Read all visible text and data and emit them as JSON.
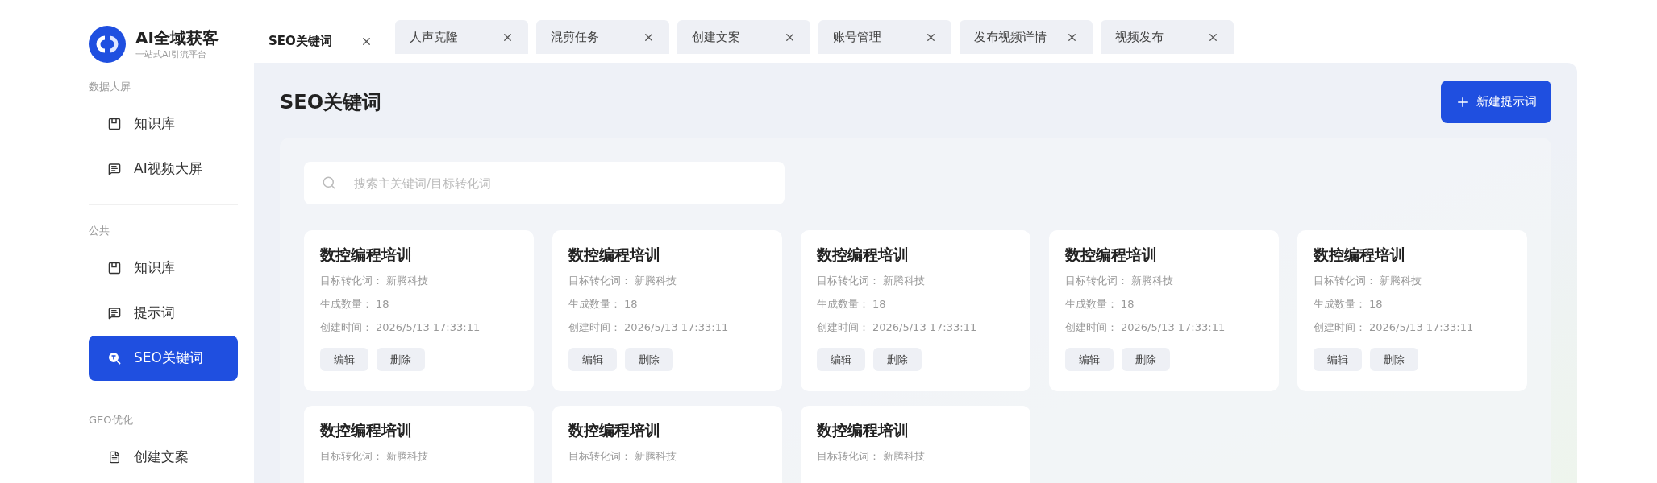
{
  "brand": {
    "title": "AI全域获客",
    "subtitle": "一站式AI引流平台"
  },
  "sidebar": {
    "sections": [
      {
        "title": "数据大屏",
        "items": [
          {
            "label": "知识库",
            "kind": "book",
            "selected": false
          },
          {
            "label": "AI视频大屏",
            "kind": "comment",
            "selected": false
          }
        ]
      },
      {
        "title": "公共",
        "items": [
          {
            "label": "知识库",
            "kind": "book",
            "selected": false
          },
          {
            "label": "提示词",
            "kind": "comment",
            "selected": false
          },
          {
            "label": "SEO关键词",
            "kind": "search",
            "selected": true
          }
        ]
      },
      {
        "title": "GEO优化",
        "items": [
          {
            "label": "创建文案",
            "kind": "doc",
            "selected": false
          }
        ]
      }
    ]
  },
  "tabs": [
    {
      "label": "SEO关键词",
      "selected": true
    },
    {
      "label": "人声克隆",
      "selected": false
    },
    {
      "label": "混剪任务",
      "selected": false
    },
    {
      "label": "创建文案",
      "selected": false
    },
    {
      "label": "账号管理",
      "selected": false
    },
    {
      "label": "发布视频详情",
      "selected": false
    },
    {
      "label": "视频发布",
      "selected": false
    }
  ],
  "page": {
    "title": "SEO关键词",
    "new_button": "新建提示词",
    "search": {
      "placeholder": "搜索主关键词/目标转化词"
    }
  },
  "cards": [
    {
      "title": "数控编程培训",
      "fields": [
        {
          "label": "目标转化词：",
          "value": "新腾科技"
        },
        {
          "label": "生成数量：",
          "value": "18"
        },
        {
          "label": "创建时间：",
          "value": "2026/5/13 17:33:11"
        }
      ],
      "buttons": [
        "编辑",
        "删除"
      ]
    },
    {
      "title": "数控编程培训",
      "fields": [
        {
          "label": "目标转化词：",
          "value": "新腾科技"
        },
        {
          "label": "生成数量：",
          "value": "18"
        },
        {
          "label": "创建时间：",
          "value": "2026/5/13 17:33:11"
        }
      ],
      "buttons": [
        "编辑",
        "删除"
      ]
    },
    {
      "title": "数控编程培训",
      "fields": [
        {
          "label": "目标转化词：",
          "value": "新腾科技"
        },
        {
          "label": "生成数量：",
          "value": "18"
        },
        {
          "label": "创建时间：",
          "value": "2026/5/13 17:33:11"
        }
      ],
      "buttons": [
        "编辑",
        "删除"
      ]
    },
    {
      "title": "数控编程培训",
      "fields": [
        {
          "label": "目标转化词：",
          "value": "新腾科技"
        },
        {
          "label": "生成数量：",
          "value": "18"
        },
        {
          "label": "创建时间：",
          "value": "2026/5/13 17:33:11"
        }
      ],
      "buttons": [
        "编辑",
        "删除"
      ]
    },
    {
      "title": "数控编程培训",
      "fields": [
        {
          "label": "目标转化词：",
          "value": "新腾科技"
        },
        {
          "label": "生成数量：",
          "value": "18"
        },
        {
          "label": "创建时间：",
          "value": "2026/5/13 17:33:11"
        }
      ],
      "buttons": [
        "编辑",
        "删除"
      ]
    },
    {
      "title": "数控编程培训",
      "fields": [
        {
          "label": "目标转化词：",
          "value": "新腾科技"
        }
      ]
    },
    {
      "title": "数控编程培训",
      "fields": [
        {
          "label": "目标转化词：",
          "value": "新腾科技"
        }
      ]
    },
    {
      "title": "数控编程培训",
      "fields": [
        {
          "label": "目标转化词：",
          "value": "新腾科技"
        }
      ]
    }
  ]
}
